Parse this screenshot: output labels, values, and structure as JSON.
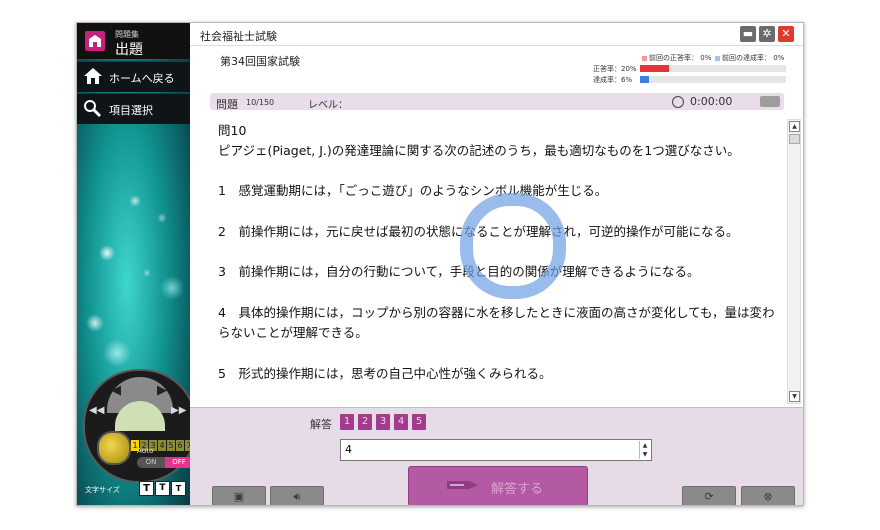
{
  "window": {
    "title": "社会福祉士試験"
  },
  "sidebar": {
    "logo_small": "問題集",
    "logo_big": "出題",
    "items": [
      {
        "label": "ホームへ戻る",
        "icon": "home-icon"
      },
      {
        "label": "項目選択",
        "icon": "item-select-icon"
      }
    ],
    "control": {
      "speed_numbers": [
        "1",
        "2",
        "3",
        "4",
        "5",
        "6",
        "7"
      ],
      "selected_speed": "1",
      "auto_label": "Auto",
      "on_label": "ON",
      "off_label": "OFF",
      "font_size_label": "文字サイズ",
      "font_buttons": [
        "T",
        "T",
        "T"
      ]
    }
  },
  "header": {
    "exam_name": "第34回国家試験",
    "legend_prev_correct": "前回の正答率：",
    "legend_prev_correct_value": "0%",
    "legend_prev_achieve": "前回の達成率：",
    "legend_prev_achieve_value": "0%",
    "correct_label": "正答率：",
    "correct_value": "20%",
    "correct_fraction": 0.2,
    "achieve_label": "達成率：",
    "achieve_value": "6%",
    "achieve_fraction": 0.06
  },
  "question_bar": {
    "label": "問題",
    "count": "10/150",
    "level_label": "レベル：",
    "timer": "0:00:00"
  },
  "question": {
    "title": "問10",
    "stem": "ピアジェ(Piaget, J.)の発達理論に関する次の記述のうち，最も適切なものを1つ選びなさい。",
    "choices": [
      "1　感覚運動期には，「ごっこ遊び」のようなシンボル機能が生じる。",
      "2　前操作期には，元に戻せば最初の状態になることが理解され，可逆的操作が可能になる。",
      "3　前操作期には，自分の行動について，手段と目的の関係が理解できるようになる。",
      "4　具体的操作期には，コップから別の容器に水を移したときに液面の高さが変化しても，量は変わらないことが理解できる。",
      "5　形式的操作期には，思考の自己中心性が強くみられる。"
    ]
  },
  "answer": {
    "label": "解答",
    "options": [
      "1",
      "2",
      "3",
      "4",
      "5"
    ],
    "value": "4",
    "submit_label": "解答する"
  },
  "colors": {
    "accent": "#c4237a",
    "answer_button": "#a13c8c",
    "correct_bar": "#e63338",
    "achieve_bar": "#3f7fe0",
    "spinner": "#6ea0e6"
  }
}
